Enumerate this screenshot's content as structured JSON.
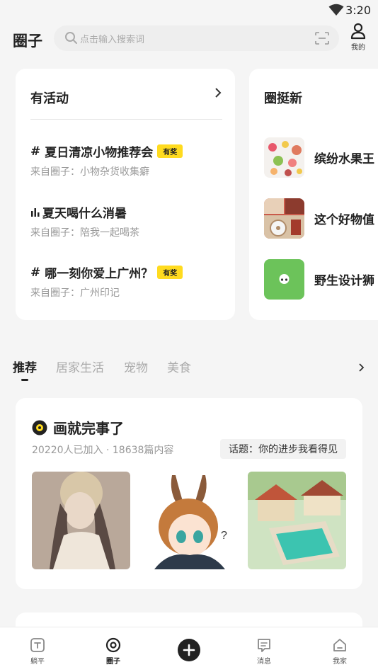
{
  "status_bar": {
    "time": "3:20"
  },
  "header": {
    "title": "圈子",
    "search_placeholder": "点击输入搜索词",
    "profile_label": "我的"
  },
  "activity_card": {
    "title": "有活动",
    "items": [
      {
        "prefix": "#",
        "title": "夏日清凉小物推荐会",
        "badge": "有奖",
        "source": "来自圈子：小物杂货收集癖"
      },
      {
        "prefix": "",
        "title": "夏天喝什么消暑",
        "badge": "",
        "source": "来自圈子：陪我一起喝茶"
      },
      {
        "prefix": "#",
        "title": "哪一刻你爱上广州？",
        "badge": "有奖",
        "source": "来自圈子：广州印记"
      }
    ]
  },
  "trend_card": {
    "title": "圈挺新",
    "items": [
      {
        "name": "缤纷水果王"
      },
      {
        "name": "这个好物值"
      },
      {
        "name": "野生设计狮"
      }
    ]
  },
  "tabs": {
    "items": [
      "推荐",
      "居家生活",
      "宠物",
      "美食"
    ],
    "active": "推荐"
  },
  "circle": {
    "name": "画就完事了",
    "stats": "20220人已加入 · 18638篇内容",
    "topic": "话题：你的进步我看得见"
  },
  "bottom_nav": {
    "items": [
      {
        "label": "躺平"
      },
      {
        "label": "圈子"
      },
      {
        "label": "消息"
      },
      {
        "label": "我家"
      }
    ]
  },
  "colors": {
    "accent_badge": "#ffdb1f",
    "background": "#f5f5f5",
    "card": "#ffffff"
  }
}
